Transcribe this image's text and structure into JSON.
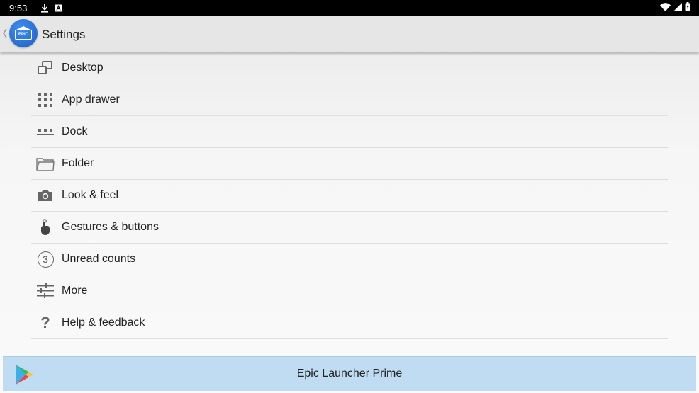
{
  "status_bar": {
    "time": "9:53",
    "icons": [
      "download-icon",
      "a-notification-icon",
      "wifi-icon",
      "signal-icon",
      "battery-icon"
    ]
  },
  "app_bar": {
    "title": "Settings",
    "logo_text": "EPIC"
  },
  "settings": {
    "items": [
      {
        "label": "Desktop",
        "icon": "desktop-icon"
      },
      {
        "label": "App drawer",
        "icon": "app-drawer-icon"
      },
      {
        "label": "Dock",
        "icon": "dock-icon"
      },
      {
        "label": "Folder",
        "icon": "folder-icon"
      },
      {
        "label": "Look & feel",
        "icon": "camera-icon"
      },
      {
        "label": "Gestures & buttons",
        "icon": "gesture-icon"
      },
      {
        "label": "Unread counts",
        "icon": "unread-count-icon",
        "badge": "3"
      },
      {
        "label": "More",
        "icon": "sliders-icon"
      },
      {
        "label": "Help & feedback",
        "icon": "help-icon",
        "glyph": "?"
      }
    ]
  },
  "promo": {
    "label": "Epic Launcher Prime",
    "icon": "play-store-icon"
  },
  "colors": {
    "status_bar": "#000000",
    "app_bar": "#e6e6e6",
    "promo_bg": "#bfdcf2",
    "logo_blue": "#2a73d8",
    "icon_gray": "#666666"
  }
}
